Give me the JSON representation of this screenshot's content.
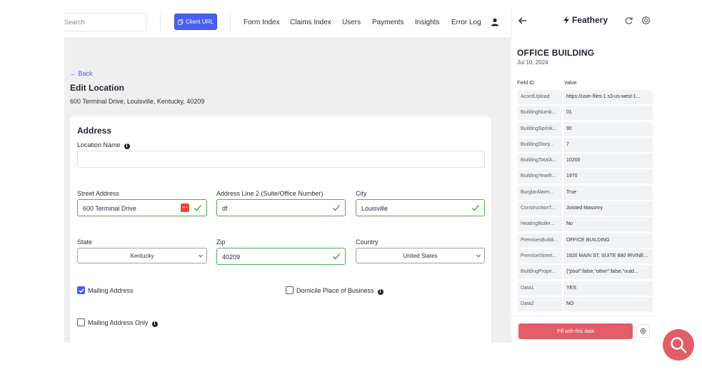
{
  "nav": {
    "search_placeholder": "Search",
    "client_url_label": "Client URL",
    "items": [
      "Form Index",
      "Claims Index",
      "Users",
      "Payments",
      "Insights",
      "Error Log"
    ]
  },
  "page": {
    "back_label": "← Back",
    "title": "Edit Location",
    "subtitle": "600 Terminal Drive, Louisville, Kentucky, 40209"
  },
  "form": {
    "section_title": "Address",
    "location_name": {
      "label": "Location Name",
      "value": ""
    },
    "street": {
      "label": "Street Address",
      "value": "600 Terminal Drive"
    },
    "address2": {
      "label": "Address Line 2 (Suite/Office Number)",
      "value": "df"
    },
    "city": {
      "label": "City",
      "value": "Louisville"
    },
    "state": {
      "label": "State",
      "value": "Kentucky"
    },
    "zip": {
      "label": "Zip",
      "value": "40209"
    },
    "country": {
      "label": "Country",
      "value": "United States"
    },
    "mailing_address": {
      "label": "Mailing Address",
      "checked": true
    },
    "domicile": {
      "label": "Domicile Place of Business",
      "checked": false
    },
    "mailing_only": {
      "label": "Mailing Address Only",
      "checked": false
    }
  },
  "panel": {
    "brand": "Feathery",
    "title": "OFFICE BUILDING",
    "date": "Jul 10, 2024",
    "col_field": "Field ID",
    "col_value": "Value",
    "rows": [
      {
        "k": "AcordUpload",
        "v": "https://user-files-1.s3-us-west-1..."
      },
      {
        "k": "BuildingNumb...",
        "v": "01"
      },
      {
        "k": "BuildingSprink...",
        "v": "90"
      },
      {
        "k": "BuildingStory...",
        "v": "7"
      },
      {
        "k": "BuildingTotalA...",
        "v": "10200"
      },
      {
        "k": "BuildingYearB...",
        "v": "1970"
      },
      {
        "k": "BurglarAlarm...",
        "v": "True"
      },
      {
        "k": "ConstructionT...",
        "v": "Joisted Masonry"
      },
      {
        "k": "HeatingBoiler...",
        "v": "No"
      },
      {
        "k": "PremisesBuildi...",
        "v": "OFFICE BUILDING"
      },
      {
        "k": "PremiseStreet...",
        "v": "1920 MAIN ST, SUITE 880 IRVINE..."
      },
      {
        "k": "BuildingPrope...",
        "v": "{\"pool\":false,\"other\":false,\"outd..."
      },
      {
        "k": "Data1",
        "v": "YES"
      },
      {
        "k": "Data2",
        "v": "NO"
      }
    ],
    "fill_button": "Fill with this data"
  },
  "colors": {
    "accent": "#4a5ef0",
    "danger": "#e35d68",
    "valid": "#4caf50"
  }
}
